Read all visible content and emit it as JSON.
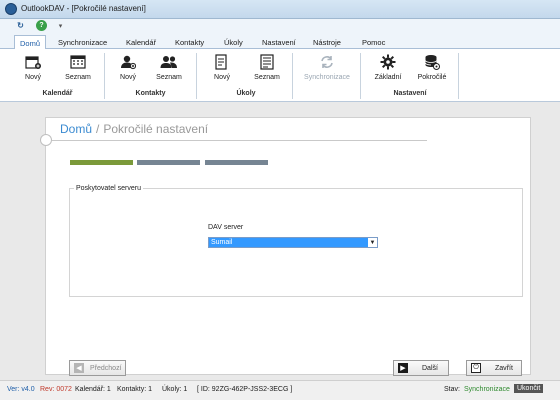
{
  "window": {
    "title": "OutlookDAV - [Pokročilé nastavení]"
  },
  "tabs": [
    "Domů",
    "Synchronizace",
    "Kalendář",
    "Kontakty",
    "Úkoly",
    "Nastavení",
    "Nástroje",
    "Pomoc"
  ],
  "ribbon": {
    "kalendar": {
      "new_label": "Nový",
      "list_label": "Seznam",
      "group_label": "Kalendář"
    },
    "kontakty": {
      "new_label": "Nový",
      "list_label": "Seznam",
      "group_label": "Kontakty"
    },
    "ukoly": {
      "new_label": "Nový",
      "list_label": "Seznam",
      "group_label": "Úkoly"
    },
    "sync": {
      "label": "Synchronizace"
    },
    "nastaveni": {
      "basic_label": "Základní",
      "advanced_label": "Pokročilé",
      "group_label": "Nastavení"
    }
  },
  "breadcrumb": {
    "home": "Domů",
    "separator": "/",
    "current": "Pokročilé nastavení"
  },
  "wizard": {
    "steps_total": 3,
    "current_step": 1,
    "fieldset_label": "Poskytovatel serveru",
    "dav_server_label": "DAV server",
    "dav_server_value": "Sumail"
  },
  "buttons": {
    "prev_label": "Předchozí",
    "next_label": "Další",
    "close_label": "Zavřít"
  },
  "status": {
    "version": "Ver: v4.0",
    "revision": "Rev: 0072",
    "calendar_count": "Kalendář:  1",
    "contacts_count": "Kontakty:  1",
    "tasks_count": "Úkoly:  1",
    "id": "[ ID: 92ZG-462P-JSS2-3ECG ]",
    "state_label": "Stav:",
    "state_value": "Synchronizace",
    "exit_label": "Ukončit"
  },
  "colors": {
    "accent": "#3b8bd1",
    "step_active": "#7b9a3a",
    "step_inactive": "#768593",
    "select_highlight": "#3399ff"
  }
}
